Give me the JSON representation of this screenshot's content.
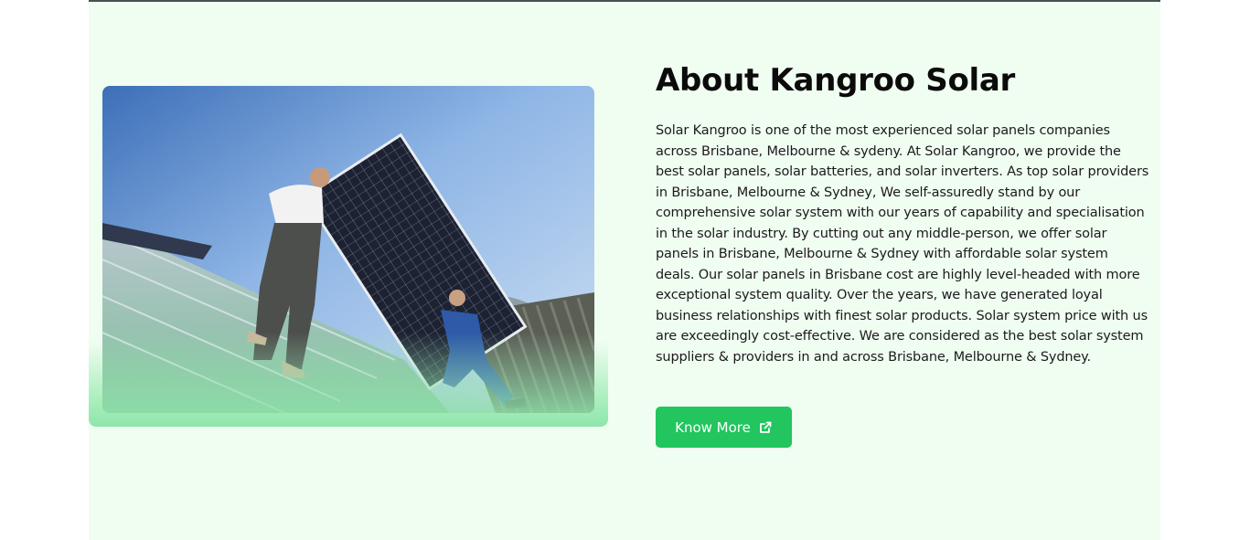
{
  "about": {
    "title": "About Kangroo Solar",
    "description": "Solar Kangroo is one of the most experienced solar panels companies across Brisbane, Melbourne & sydeny. At Solar Kangroo, we provide the best solar panels, solar batteries, and solar inverters. As top solar providers in Brisbane, Melbourne & Sydney, We self-assuredly stand by our comprehensive solar system with our years of capability and specialisation in the solar industry. By cutting out any middle-person, we offer solar panels in Brisbane, Melbourne & Sydney with affordable solar system deals. Our solar panels in Brisbane cost are highly level-headed with more exceptional system quality. Over the years, we have generated loyal business relationships with finest solar products. Solar system price with us are exceedingly cost-effective. We are considered as the best solar system suppliers & providers in and across Brisbane, Melbourne & Sydney.",
    "cta_label": "Know More",
    "cta_icon": "external-link-icon",
    "photo_subject": "workers-installing-solar-panel-photo"
  },
  "colors": {
    "section_bg": "#f0fdf1",
    "accent": "#22c55e",
    "glow": "#8fe6aa",
    "title": "#0b0b0b",
    "text": "#1b1b1b"
  }
}
